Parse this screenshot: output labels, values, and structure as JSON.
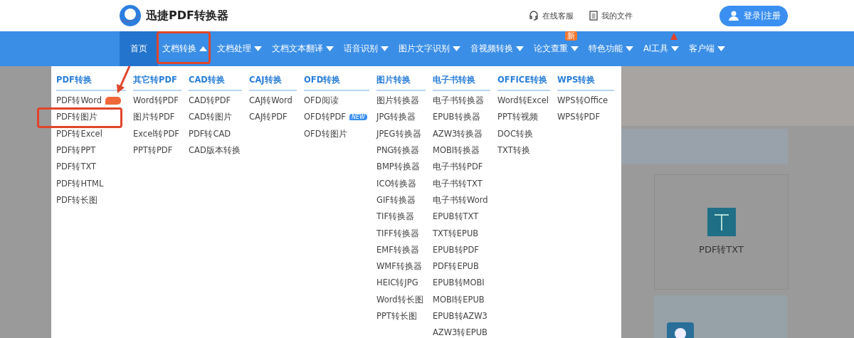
{
  "header": {
    "logo_text": "迅捷PDF转换器",
    "links": [
      {
        "kind": "support",
        "label": "在线客服"
      },
      {
        "kind": "files",
        "label": "我的文件"
      }
    ],
    "login": "登录|注册"
  },
  "nav": [
    {
      "label": "首页",
      "selected": true,
      "caret": false,
      "expanded": false
    },
    {
      "label": "文档转换",
      "selected": false,
      "caret": true,
      "expanded": true
    },
    {
      "label": "文档处理",
      "selected": false,
      "caret": true,
      "expanded": false
    },
    {
      "label": "文档文本翻译",
      "selected": false,
      "caret": true,
      "expanded": false
    },
    {
      "label": "语音识别",
      "selected": false,
      "caret": true,
      "expanded": false
    },
    {
      "label": "图片文字识别",
      "selected": false,
      "caret": true,
      "expanded": false
    },
    {
      "label": "音视频转换",
      "selected": false,
      "caret": true,
      "expanded": false
    },
    {
      "label": "论文查重",
      "selected": false,
      "caret": true,
      "expanded": false,
      "badge": "新"
    },
    {
      "label": "特色功能",
      "selected": false,
      "caret": true,
      "expanded": false
    },
    {
      "label": "AI工具",
      "selected": false,
      "caret": true,
      "expanded": false,
      "hot": true
    },
    {
      "label": "客户端",
      "selected": false,
      "caret": true,
      "expanded": false
    }
  ],
  "dropdown": [
    {
      "title": "PDF转换",
      "items": [
        {
          "label": "PDF转Word",
          "hot": true
        },
        {
          "label": "PDF转图片",
          "highlighted": true
        },
        {
          "label": "PDF转Excel"
        },
        {
          "label": "PDF转PPT"
        },
        {
          "label": "PDF转TXT"
        },
        {
          "label": "PDF转HTML"
        },
        {
          "label": "PDF转长图"
        }
      ]
    },
    {
      "title": "其它转PDF",
      "items": [
        {
          "label": "Word转PDF"
        },
        {
          "label": "图片转PDF"
        },
        {
          "label": "Excel转PDF"
        },
        {
          "label": "PPT转PDF"
        }
      ]
    },
    {
      "title": "CAD转换",
      "items": [
        {
          "label": "CAD转PDF"
        },
        {
          "label": "CAD转图片"
        },
        {
          "label": "PDF转CAD"
        },
        {
          "label": "CAD版本转换"
        }
      ]
    },
    {
      "title": "CAJ转换",
      "items": [
        {
          "label": "CAJ转Word"
        },
        {
          "label": "CAJ转PDF"
        }
      ]
    },
    {
      "title": "OFD转换",
      "items": [
        {
          "label": "OFD阅读"
        },
        {
          "label": "OFD转PDF",
          "badge": "NEW"
        },
        {
          "label": "OFD转图片"
        }
      ]
    },
    {
      "title": "图片转换",
      "items": [
        {
          "label": "图片转换器"
        },
        {
          "label": "JPG转换器"
        },
        {
          "label": "JPEG转换器"
        },
        {
          "label": "PNG转换器"
        },
        {
          "label": "BMP转换器"
        },
        {
          "label": "ICO转换器"
        },
        {
          "label": "GIF转换器"
        },
        {
          "label": "TIF转换器"
        },
        {
          "label": "TIFF转换器"
        },
        {
          "label": "EMF转换器"
        },
        {
          "label": "WMF转换器"
        },
        {
          "label": "HEIC转JPG"
        },
        {
          "label": "Word转长图"
        },
        {
          "label": "PPT转长图"
        }
      ]
    },
    {
      "title": "电子书转换",
      "items": [
        {
          "label": "电子书转换器"
        },
        {
          "label": "EPUB转换器"
        },
        {
          "label": "AZW3转换器"
        },
        {
          "label": "MOBI转换器"
        },
        {
          "label": "电子书转PDF"
        },
        {
          "label": "电子书转TXT"
        },
        {
          "label": "电子书转Word"
        },
        {
          "label": "EPUB转TXT"
        },
        {
          "label": "TXT转EPUB"
        },
        {
          "label": "EPUB转PDF"
        },
        {
          "label": "PDF转EPUB"
        },
        {
          "label": "EPUB转MOBI"
        },
        {
          "label": "MOBI转EPUB"
        },
        {
          "label": "EPUB转AZW3"
        },
        {
          "label": "AZW3转EPUB"
        }
      ]
    },
    {
      "title": "OFFICE转换",
      "items": [
        {
          "label": "Word转Excel"
        },
        {
          "label": "PPT转视频"
        },
        {
          "label": "DOC转换"
        },
        {
          "label": "TXT转换"
        }
      ]
    },
    {
      "title": "WPS转换",
      "items": [
        {
          "label": "WPS转Office"
        },
        {
          "label": "WPS转PDF"
        }
      ]
    }
  ],
  "background_card": {
    "label": "PDF转TXT"
  }
}
